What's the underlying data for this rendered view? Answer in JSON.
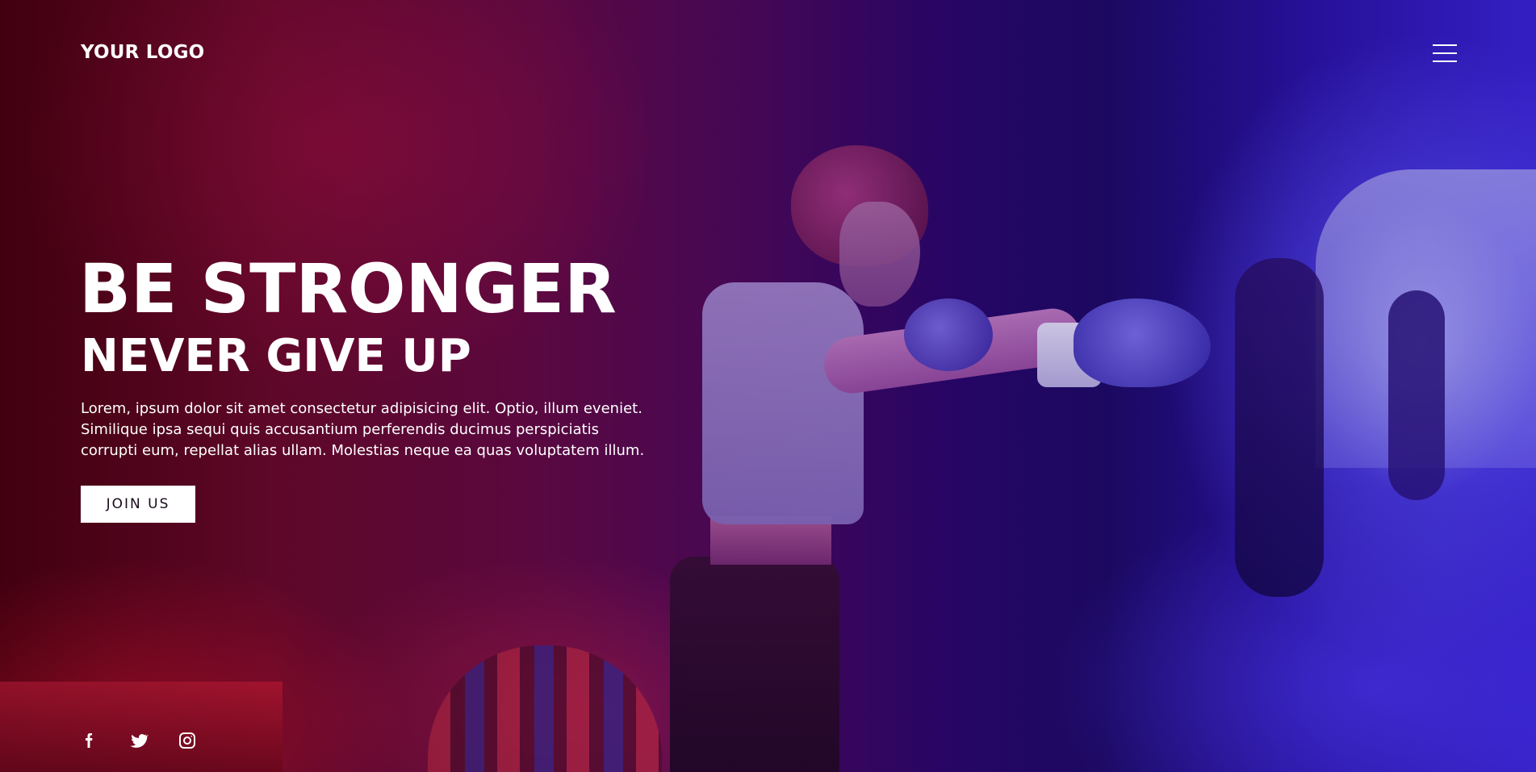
{
  "header": {
    "logo_text": "YOUR LOGO",
    "menu_icon": "hamburger-menu-icon"
  },
  "hero": {
    "headline": "BE STRONGER",
    "subheadline": "NEVER GIVE UP",
    "description_lines": [
      "Lorem, ipsum dolor sit amet consectetur adipisicing elit. Optio, illum eveniet.",
      "Similique ipsa sequi quis accusantium perferendis ducimus perspiciatis",
      "corrupti eum, repellat alias ullam. Molestias neque ea quas voluptatem illum."
    ],
    "cta_label": "JOIN US"
  },
  "social": {
    "icons": [
      "facebook-icon",
      "twitter-icon",
      "instagram-icon"
    ]
  },
  "colors": {
    "text": "#ffffff",
    "button_bg": "#ffffff",
    "button_text": "#1a0a1a",
    "accent_red": "#d41a3a",
    "accent_blue": "#3a22d8"
  }
}
